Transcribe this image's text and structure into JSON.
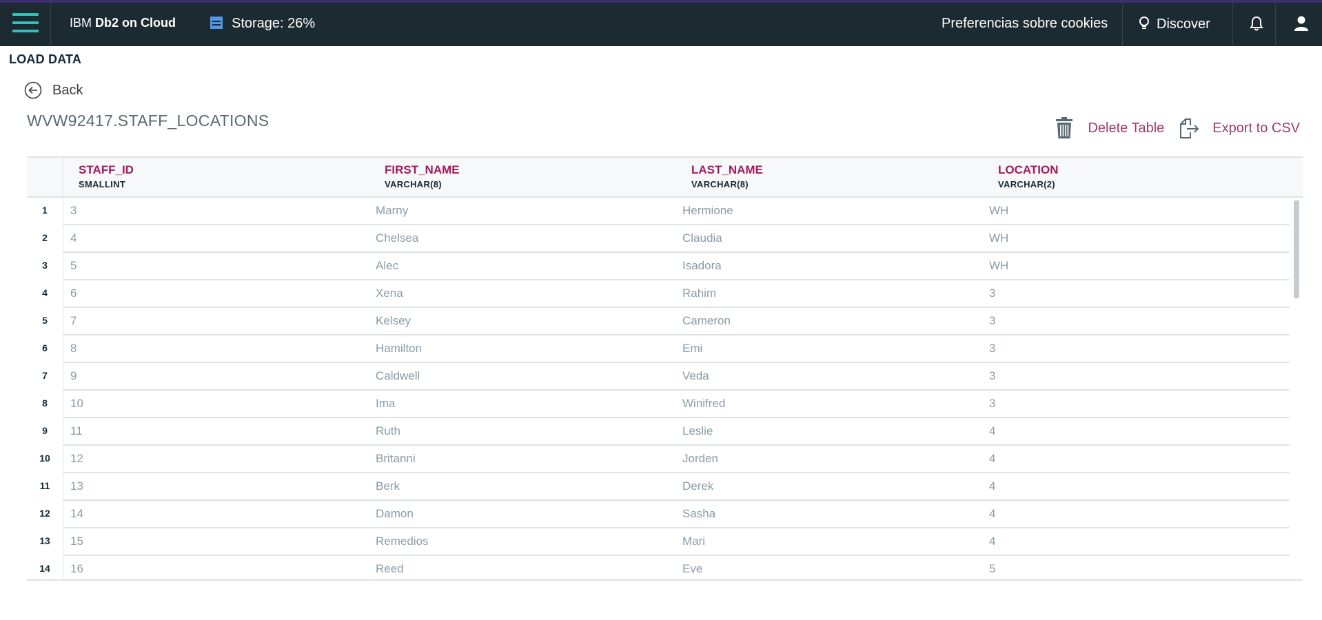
{
  "topbar": {
    "brand_prefix": "IBM",
    "brand_name": "Db2 on Cloud",
    "storage": "Storage: 26%",
    "cookies": "Preferencias sobre cookies",
    "discover": "Discover"
  },
  "page": {
    "title": "LOAD DATA",
    "back": "Back",
    "table_name": "WVW92417.STAFF_LOCATIONS",
    "delete_table": "Delete Table",
    "export_csv": "Export to CSV"
  },
  "table": {
    "columns": [
      {
        "name": "STAFF_ID",
        "type": "SMALLINT"
      },
      {
        "name": "FIRST_NAME",
        "type": "VARCHAR(8)"
      },
      {
        "name": "LAST_NAME",
        "type": "VARCHAR(8)"
      },
      {
        "name": "LOCATION",
        "type": "VARCHAR(2)"
      }
    ],
    "rows": [
      {
        "n": "1",
        "cells": [
          "3",
          "Marny",
          "Hermione",
          "WH"
        ]
      },
      {
        "n": "2",
        "cells": [
          "4",
          "Chelsea",
          "Claudia",
          "WH"
        ]
      },
      {
        "n": "3",
        "cells": [
          "5",
          "Alec",
          "Isadora",
          "WH"
        ]
      },
      {
        "n": "4",
        "cells": [
          "6",
          "Xena",
          "Rahim",
          "3"
        ]
      },
      {
        "n": "5",
        "cells": [
          "7",
          "Kelsey",
          "Cameron",
          "3"
        ]
      },
      {
        "n": "6",
        "cells": [
          "8",
          "Hamilton",
          "Emi",
          "3"
        ]
      },
      {
        "n": "7",
        "cells": [
          "9",
          "Caldwell",
          "Veda",
          "3"
        ]
      },
      {
        "n": "8",
        "cells": [
          "10",
          "Ima",
          "Winifred",
          "3"
        ]
      },
      {
        "n": "9",
        "cells": [
          "11",
          "Ruth",
          "Leslie",
          "4"
        ]
      },
      {
        "n": "10",
        "cells": [
          "12",
          "Britanni",
          "Jorden",
          "4"
        ]
      },
      {
        "n": "11",
        "cells": [
          "13",
          "Berk",
          "Derek",
          "4"
        ]
      },
      {
        "n": "12",
        "cells": [
          "14",
          "Damon",
          "Sasha",
          "4"
        ]
      },
      {
        "n": "13",
        "cells": [
          "15",
          "Remedios",
          "Mari",
          "4"
        ]
      },
      {
        "n": "14",
        "cells": [
          "16",
          "Reed",
          "Eve",
          "5"
        ]
      }
    ]
  },
  "colors": {
    "topbar_bg": "#1c2a31",
    "accent_teal": "#2fc1b9",
    "column_header": "#a2195b",
    "action_link": "#9c3b6a"
  }
}
